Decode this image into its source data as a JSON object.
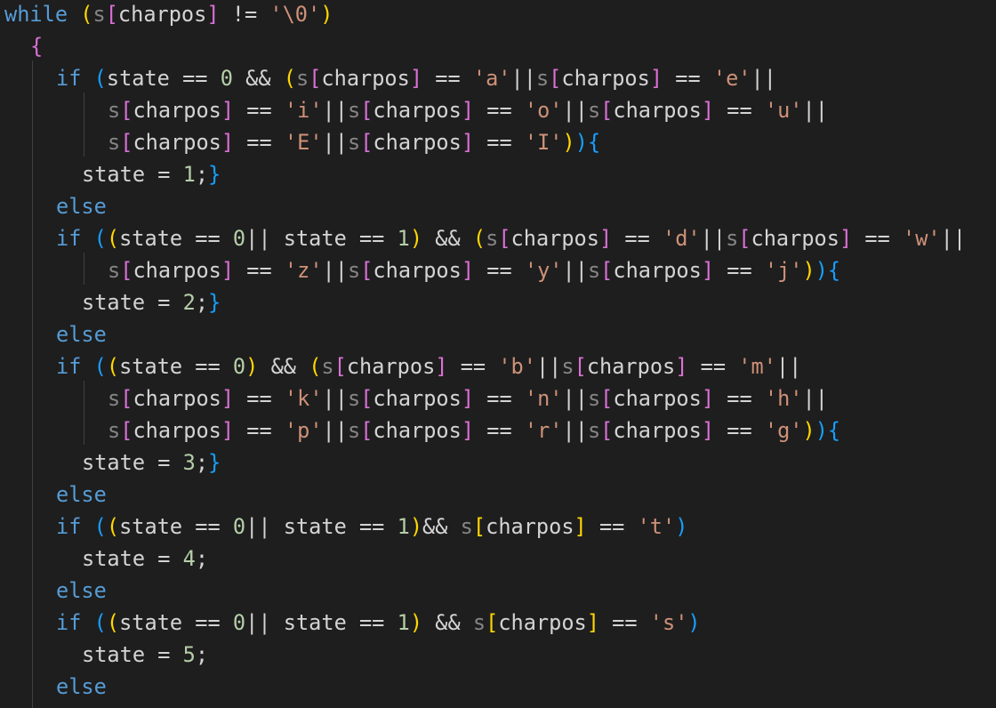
{
  "editor": {
    "lines": [
      {
        "indent": 0,
        "tokens": [
          [
            "kw",
            "while"
          ],
          [
            "var",
            " "
          ],
          [
            "br1",
            "("
          ],
          [
            "arr",
            "s"
          ],
          [
            "br2",
            "["
          ],
          [
            "prop",
            "charpos"
          ],
          [
            "br2",
            "]"
          ],
          [
            "var",
            " != "
          ],
          [
            "str",
            "'\\0'"
          ],
          [
            "br1",
            ")"
          ]
        ]
      },
      {
        "indent": 1,
        "tokens": [
          [
            "br2",
            "{"
          ]
        ]
      },
      {
        "indent": 2,
        "tokens": [
          [
            "kw",
            "if"
          ],
          [
            "var",
            " "
          ],
          [
            "br3",
            "("
          ],
          [
            "var",
            "state == "
          ],
          [
            "num",
            "0"
          ],
          [
            "var",
            " && "
          ],
          [
            "br1",
            "("
          ],
          [
            "arr",
            "s"
          ],
          [
            "br2",
            "["
          ],
          [
            "prop",
            "charpos"
          ],
          [
            "br2",
            "]"
          ],
          [
            "var",
            " == "
          ],
          [
            "str",
            "'a'"
          ],
          [
            "var",
            "||"
          ],
          [
            "arr",
            "s"
          ],
          [
            "br2",
            "["
          ],
          [
            "prop",
            "charpos"
          ],
          [
            "br2",
            "]"
          ],
          [
            "var",
            " == "
          ],
          [
            "str",
            "'e'"
          ],
          [
            "var",
            "||"
          ]
        ]
      },
      {
        "indent": 4,
        "tokens": [
          [
            "arr",
            "s"
          ],
          [
            "br2",
            "["
          ],
          [
            "prop",
            "charpos"
          ],
          [
            "br2",
            "]"
          ],
          [
            "var",
            " == "
          ],
          [
            "str",
            "'i'"
          ],
          [
            "var",
            "||"
          ],
          [
            "arr",
            "s"
          ],
          [
            "br2",
            "["
          ],
          [
            "prop",
            "charpos"
          ],
          [
            "br2",
            "]"
          ],
          [
            "var",
            " == "
          ],
          [
            "str",
            "'o'"
          ],
          [
            "var",
            "||"
          ],
          [
            "arr",
            "s"
          ],
          [
            "br2",
            "["
          ],
          [
            "prop",
            "charpos"
          ],
          [
            "br2",
            "]"
          ],
          [
            "var",
            " == "
          ],
          [
            "str",
            "'u'"
          ],
          [
            "var",
            "||"
          ]
        ]
      },
      {
        "indent": 4,
        "tokens": [
          [
            "arr",
            "s"
          ],
          [
            "br2",
            "["
          ],
          [
            "prop",
            "charpos"
          ],
          [
            "br2",
            "]"
          ],
          [
            "var",
            " == "
          ],
          [
            "str",
            "'E'"
          ],
          [
            "var",
            "||"
          ],
          [
            "arr",
            "s"
          ],
          [
            "br2",
            "["
          ],
          [
            "prop",
            "charpos"
          ],
          [
            "br2",
            "]"
          ],
          [
            "var",
            " == "
          ],
          [
            "str",
            "'I'"
          ],
          [
            "br1",
            ")"
          ],
          [
            "br3",
            ")"
          ],
          [
            "br3",
            "{"
          ]
        ]
      },
      {
        "indent": 3,
        "tokens": [
          [
            "var",
            "state = "
          ],
          [
            "num",
            "1"
          ],
          [
            "var",
            ";"
          ],
          [
            "br3",
            "}"
          ]
        ]
      },
      {
        "indent": 2,
        "tokens": [
          [
            "kw",
            "else"
          ]
        ]
      },
      {
        "indent": 2,
        "tokens": [
          [
            "kw",
            "if"
          ],
          [
            "var",
            " "
          ],
          [
            "br3",
            "("
          ],
          [
            "br1",
            "("
          ],
          [
            "var",
            "state == "
          ],
          [
            "num",
            "0"
          ],
          [
            "var",
            "|| state == "
          ],
          [
            "num",
            "1"
          ],
          [
            "br1",
            ")"
          ],
          [
            "var",
            " && "
          ],
          [
            "br1",
            "("
          ],
          [
            "arr",
            "s"
          ],
          [
            "br2",
            "["
          ],
          [
            "prop",
            "charpos"
          ],
          [
            "br2",
            "]"
          ],
          [
            "var",
            " == "
          ],
          [
            "str",
            "'d'"
          ],
          [
            "var",
            "||"
          ],
          [
            "arr",
            "s"
          ],
          [
            "br2",
            "["
          ],
          [
            "prop",
            "charpos"
          ],
          [
            "br2",
            "]"
          ],
          [
            "var",
            " == "
          ],
          [
            "str",
            "'w'"
          ],
          [
            "var",
            "||"
          ]
        ]
      },
      {
        "indent": 4,
        "tokens": [
          [
            "arr",
            "s"
          ],
          [
            "br2",
            "["
          ],
          [
            "prop",
            "charpos"
          ],
          [
            "br2",
            "]"
          ],
          [
            "var",
            " == "
          ],
          [
            "str",
            "'z'"
          ],
          [
            "var",
            "||"
          ],
          [
            "arr",
            "s"
          ],
          [
            "br2",
            "["
          ],
          [
            "prop",
            "charpos"
          ],
          [
            "br2",
            "]"
          ],
          [
            "var",
            " == "
          ],
          [
            "str",
            "'y'"
          ],
          [
            "var",
            "||"
          ],
          [
            "arr",
            "s"
          ],
          [
            "br2",
            "["
          ],
          [
            "prop",
            "charpos"
          ],
          [
            "br2",
            "]"
          ],
          [
            "var",
            " == "
          ],
          [
            "str",
            "'j'"
          ],
          [
            "br1",
            ")"
          ],
          [
            "br3",
            ")"
          ],
          [
            "br3",
            "{"
          ]
        ]
      },
      {
        "indent": 3,
        "tokens": [
          [
            "var",
            "state = "
          ],
          [
            "num",
            "2"
          ],
          [
            "var",
            ";"
          ],
          [
            "br3",
            "}"
          ]
        ]
      },
      {
        "indent": 2,
        "tokens": [
          [
            "kw",
            "else"
          ]
        ]
      },
      {
        "indent": 2,
        "tokens": [
          [
            "kw",
            "if"
          ],
          [
            "var",
            " "
          ],
          [
            "br3",
            "("
          ],
          [
            "br1",
            "("
          ],
          [
            "var",
            "state == "
          ],
          [
            "num",
            "0"
          ],
          [
            "br1",
            ")"
          ],
          [
            "var",
            " && "
          ],
          [
            "br1",
            "("
          ],
          [
            "arr",
            "s"
          ],
          [
            "br2",
            "["
          ],
          [
            "prop",
            "charpos"
          ],
          [
            "br2",
            "]"
          ],
          [
            "var",
            " == "
          ],
          [
            "str",
            "'b'"
          ],
          [
            "var",
            "||"
          ],
          [
            "arr",
            "s"
          ],
          [
            "br2",
            "["
          ],
          [
            "prop",
            "charpos"
          ],
          [
            "br2",
            "]"
          ],
          [
            "var",
            " == "
          ],
          [
            "str",
            "'m'"
          ],
          [
            "var",
            "||"
          ]
        ]
      },
      {
        "indent": 4,
        "tokens": [
          [
            "arr",
            "s"
          ],
          [
            "br2",
            "["
          ],
          [
            "prop",
            "charpos"
          ],
          [
            "br2",
            "]"
          ],
          [
            "var",
            " == "
          ],
          [
            "str",
            "'k'"
          ],
          [
            "var",
            "||"
          ],
          [
            "arr",
            "s"
          ],
          [
            "br2",
            "["
          ],
          [
            "prop",
            "charpos"
          ],
          [
            "br2",
            "]"
          ],
          [
            "var",
            " == "
          ],
          [
            "str",
            "'n'"
          ],
          [
            "var",
            "||"
          ],
          [
            "arr",
            "s"
          ],
          [
            "br2",
            "["
          ],
          [
            "prop",
            "charpos"
          ],
          [
            "br2",
            "]"
          ],
          [
            "var",
            " == "
          ],
          [
            "str",
            "'h'"
          ],
          [
            "var",
            "||"
          ]
        ]
      },
      {
        "indent": 4,
        "tokens": [
          [
            "arr",
            "s"
          ],
          [
            "br2",
            "["
          ],
          [
            "prop",
            "charpos"
          ],
          [
            "br2",
            "]"
          ],
          [
            "var",
            " == "
          ],
          [
            "str",
            "'p'"
          ],
          [
            "var",
            "||"
          ],
          [
            "arr",
            "s"
          ],
          [
            "br2",
            "["
          ],
          [
            "prop",
            "charpos"
          ],
          [
            "br2",
            "]"
          ],
          [
            "var",
            " == "
          ],
          [
            "str",
            "'r'"
          ],
          [
            "var",
            "||"
          ],
          [
            "arr",
            "s"
          ],
          [
            "br2",
            "["
          ],
          [
            "prop",
            "charpos"
          ],
          [
            "br2",
            "]"
          ],
          [
            "var",
            " == "
          ],
          [
            "str",
            "'g'"
          ],
          [
            "br1",
            ")"
          ],
          [
            "br3",
            ")"
          ],
          [
            "br3",
            "{"
          ]
        ]
      },
      {
        "indent": 3,
        "tokens": [
          [
            "var",
            "state = "
          ],
          [
            "num",
            "3"
          ],
          [
            "var",
            ";"
          ],
          [
            "br3",
            "}"
          ]
        ]
      },
      {
        "indent": 2,
        "tokens": [
          [
            "kw",
            "else"
          ]
        ]
      },
      {
        "indent": 2,
        "tokens": [
          [
            "kw",
            "if"
          ],
          [
            "var",
            " "
          ],
          [
            "br3",
            "("
          ],
          [
            "br1",
            "("
          ],
          [
            "var",
            "state == "
          ],
          [
            "num",
            "0"
          ],
          [
            "var",
            "|| state == "
          ],
          [
            "num",
            "1"
          ],
          [
            "br1",
            ")"
          ],
          [
            "var",
            "&& "
          ],
          [
            "arr",
            "s"
          ],
          [
            "br1",
            "["
          ],
          [
            "prop",
            "charpos"
          ],
          [
            "br1",
            "]"
          ],
          [
            "var",
            " == "
          ],
          [
            "str",
            "'t'"
          ],
          [
            "br3",
            ")"
          ]
        ]
      },
      {
        "indent": 3,
        "tokens": [
          [
            "var",
            "state = "
          ],
          [
            "num",
            "4"
          ],
          [
            "var",
            ";"
          ]
        ]
      },
      {
        "indent": 2,
        "tokens": [
          [
            "kw",
            "else"
          ]
        ]
      },
      {
        "indent": 2,
        "tokens": [
          [
            "kw",
            "if"
          ],
          [
            "var",
            " "
          ],
          [
            "br3",
            "("
          ],
          [
            "br1",
            "("
          ],
          [
            "var",
            "state == "
          ],
          [
            "num",
            "0"
          ],
          [
            "var",
            "|| state == "
          ],
          [
            "num",
            "1"
          ],
          [
            "br1",
            ")"
          ],
          [
            "var",
            " && "
          ],
          [
            "arr",
            "s"
          ],
          [
            "br1",
            "["
          ],
          [
            "prop",
            "charpos"
          ],
          [
            "br1",
            "]"
          ],
          [
            "var",
            " == "
          ],
          [
            "str",
            "'s'"
          ],
          [
            "br3",
            ")"
          ]
        ]
      },
      {
        "indent": 3,
        "tokens": [
          [
            "var",
            "state = "
          ],
          [
            "num",
            "5"
          ],
          [
            "var",
            ";"
          ]
        ]
      },
      {
        "indent": 2,
        "tokens": [
          [
            "kw",
            "else"
          ]
        ]
      }
    ]
  },
  "colors": {
    "background": "#1e1e1e",
    "keyword": "#569cd6",
    "string": "#ce9178",
    "number": "#b5cea8",
    "bracket_yellow": "#ffd700",
    "bracket_pink": "#da70d6",
    "bracket_blue": "#179fff"
  }
}
